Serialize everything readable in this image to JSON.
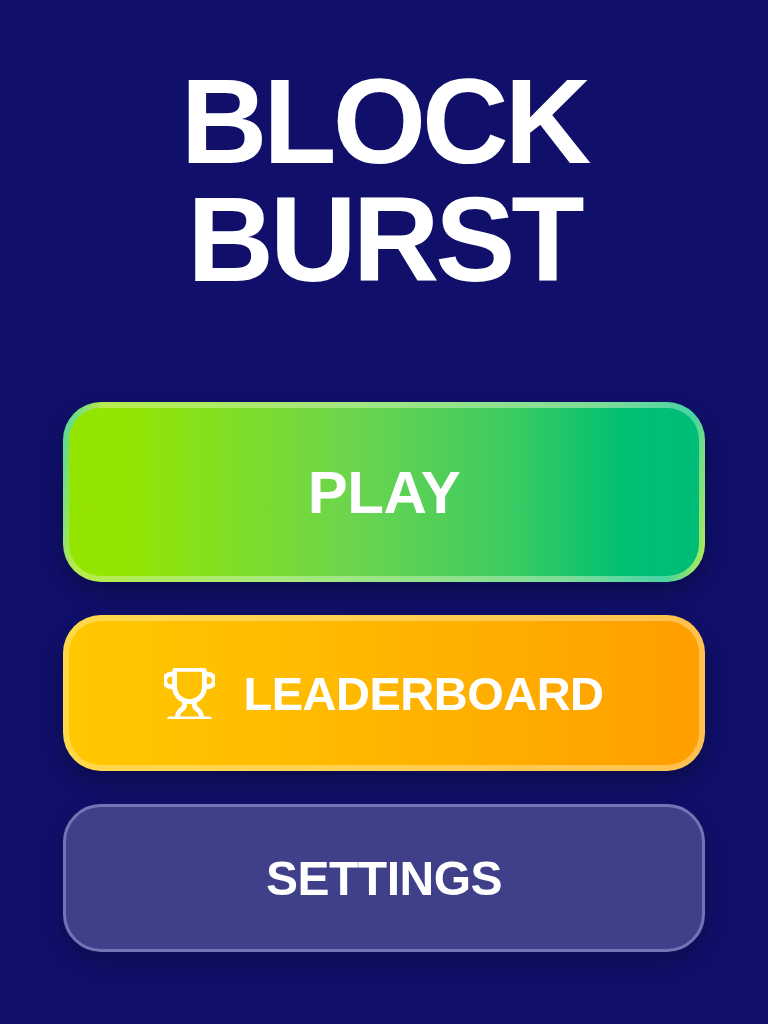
{
  "title": "BLOCK BURST",
  "buttons": [
    {
      "kind": "play",
      "label": "PLAY"
    },
    {
      "kind": "leaderboard",
      "label": "LEADERBOARD"
    },
    {
      "kind": "settings",
      "label": "SETTINGS"
    }
  ]
}
